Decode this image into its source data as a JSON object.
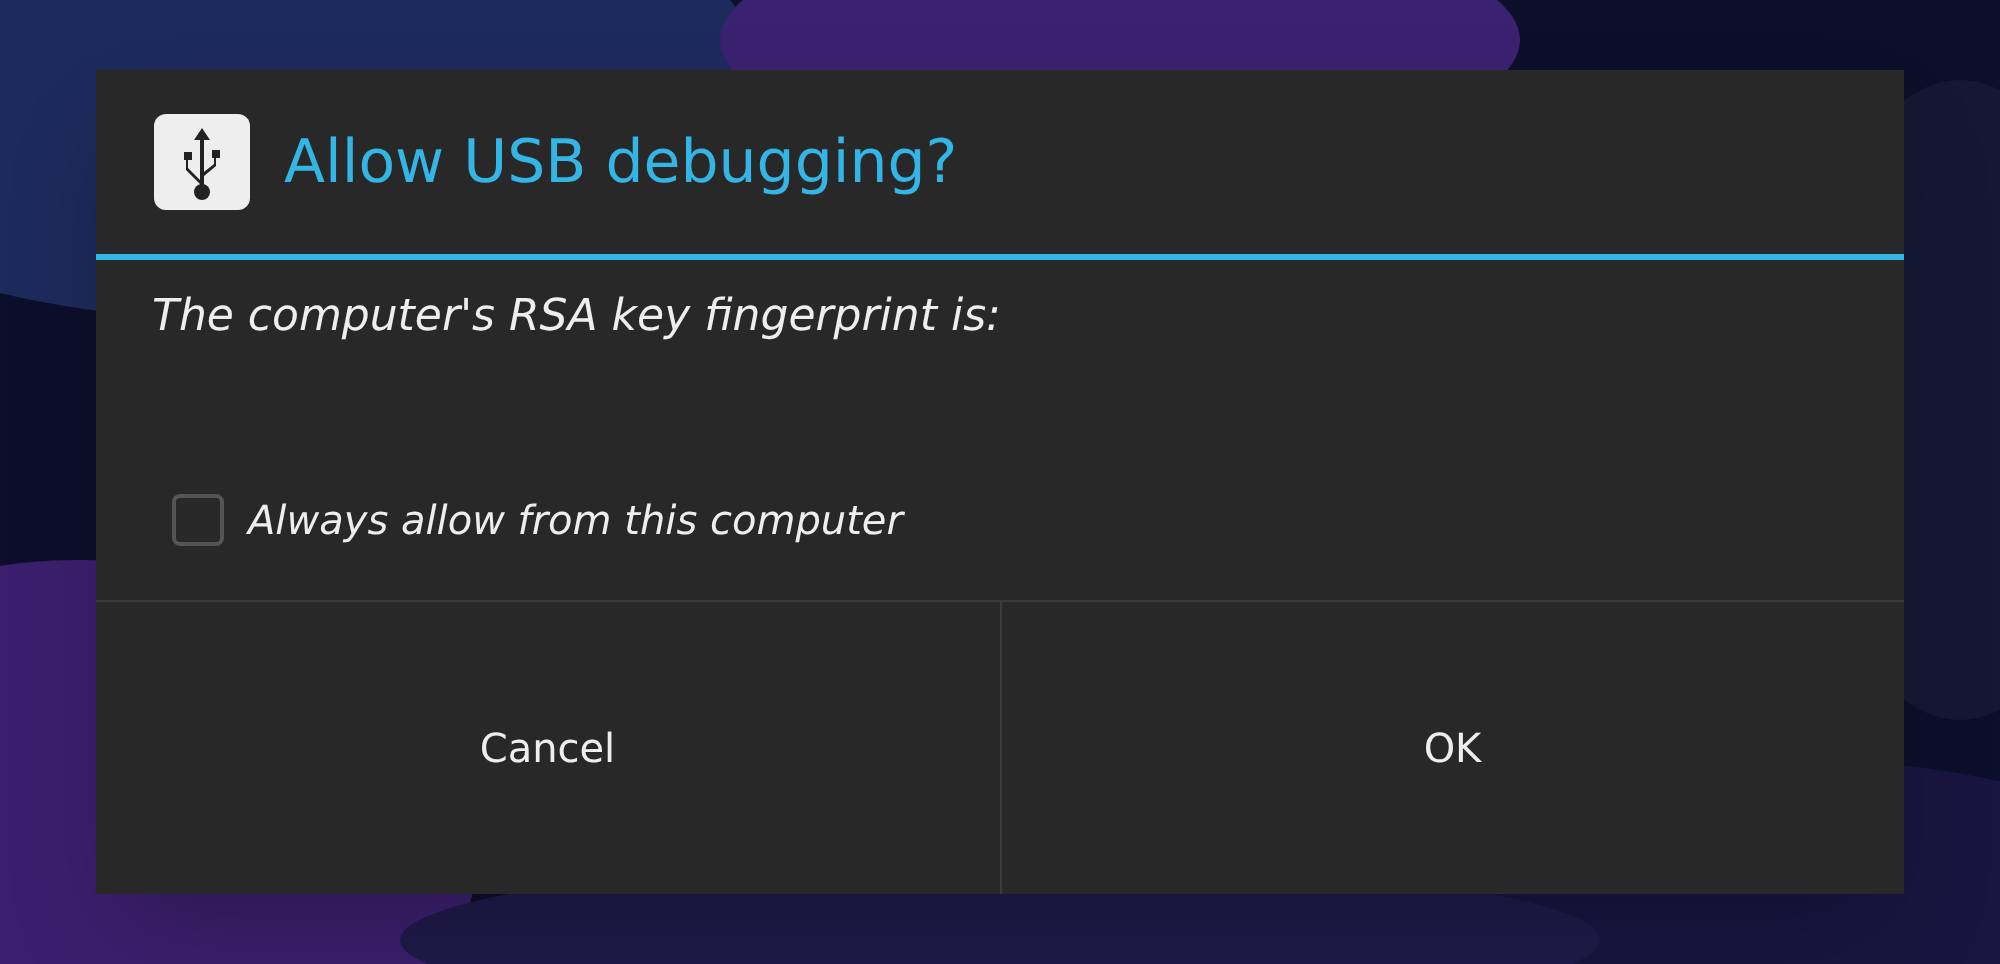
{
  "dialog": {
    "title": "Allow USB debugging?",
    "message": "The computer's RSA key fingerprint is:",
    "checkbox": {
      "label": "Always allow from this computer",
      "checked": false
    },
    "buttons": [
      "Cancel",
      "OK"
    ]
  }
}
